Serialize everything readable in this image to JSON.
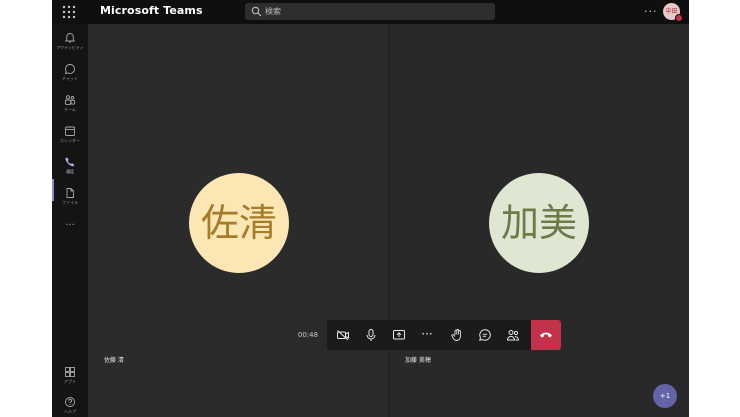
{
  "app": {
    "title": "Microsoft Teams"
  },
  "search": {
    "placeholder": "検索"
  },
  "top_bar": {
    "more": "···",
    "avatar_initials": "中田"
  },
  "rail": {
    "items": [
      {
        "label": "アクティビティ",
        "icon": "bell-icon"
      },
      {
        "label": "チャット",
        "icon": "chat-icon"
      },
      {
        "label": "チーム",
        "icon": "teams-icon"
      },
      {
        "label": "カレンダー",
        "icon": "calendar-icon"
      },
      {
        "label": "通話",
        "icon": "phone-icon",
        "active": true
      },
      {
        "label": "ファイル",
        "icon": "file-icon"
      }
    ],
    "more": "···",
    "bottom": [
      {
        "label": "アプリ",
        "icon": "apps-icon"
      },
      {
        "label": "ヘルプ",
        "icon": "help-icon"
      }
    ]
  },
  "participants": [
    {
      "initials": "佐清",
      "name": "佐藤 清",
      "color": "#fbe6b4"
    },
    {
      "initials": "加美",
      "name": "加藤 美穂",
      "color": "#dfe7d3"
    }
  ],
  "call_controls": {
    "timer": "00:48",
    "buttons": [
      "camera-off-icon",
      "microphone-icon",
      "share-screen-icon",
      "more-icon",
      "raise-hand-icon",
      "chat-icon",
      "participants-icon",
      "hang-up-icon"
    ],
    "more": "···",
    "hangup_color": "#c4314b"
  },
  "overflow_badge": "+1",
  "colors": {
    "accent": "#6264a7",
    "hangup": "#c4314b"
  }
}
